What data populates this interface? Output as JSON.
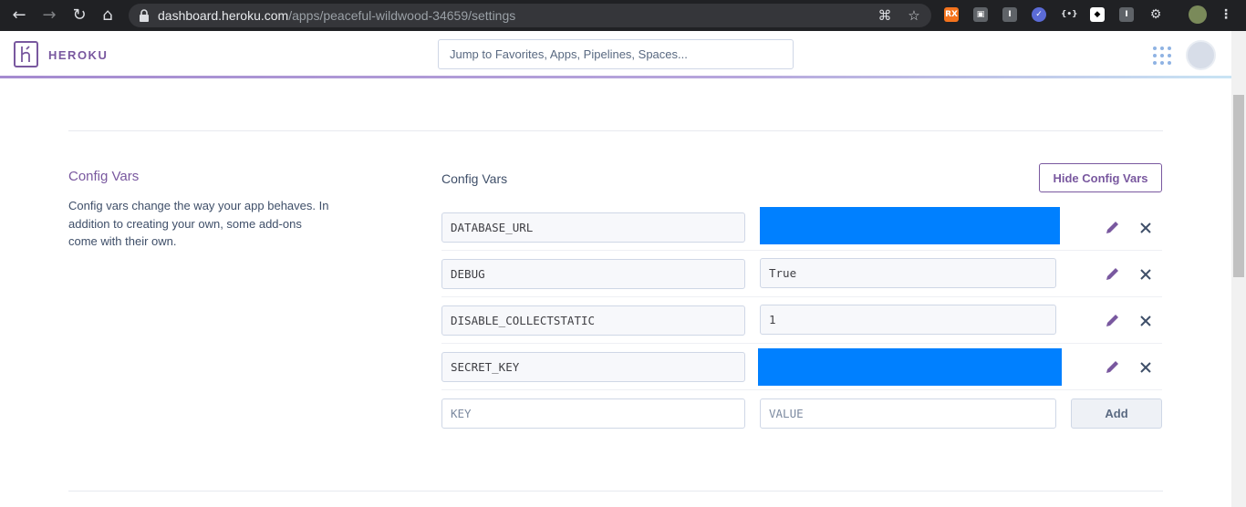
{
  "browser": {
    "url_host": "dashboard.heroku.com",
    "url_path": "/apps/peaceful-wildwood-34659/settings",
    "icons": [
      "back-icon",
      "forward-icon",
      "reload-icon",
      "home-icon",
      "lock-icon",
      "translate-icon",
      "star-icon",
      "menu-icon"
    ]
  },
  "header": {
    "brand": "HEROKU",
    "search_placeholder": "Jump to Favorites, Apps, Pipelines, Spaces..."
  },
  "section": {
    "title": "Config Vars",
    "description": "Config vars change the way your app behaves. In addition to creating your own, some add-ons come with their own."
  },
  "config": {
    "label": "Config Vars",
    "hide_button": "Hide Config Vars",
    "vars": [
      {
        "key": "DATABASE_URL",
        "value": "",
        "redacted": true
      },
      {
        "key": "DEBUG",
        "value": "True",
        "redacted": false
      },
      {
        "key": "DISABLE_COLLECTSTATIC",
        "value": "1",
        "redacted": false
      },
      {
        "key": "SECRET_KEY",
        "value": "",
        "redacted": true
      }
    ],
    "new_key_placeholder": "KEY",
    "new_value_placeholder": "VALUE",
    "add_button": "Add"
  },
  "colors": {
    "brand": "#79589f",
    "redaction": "#0080ff"
  }
}
